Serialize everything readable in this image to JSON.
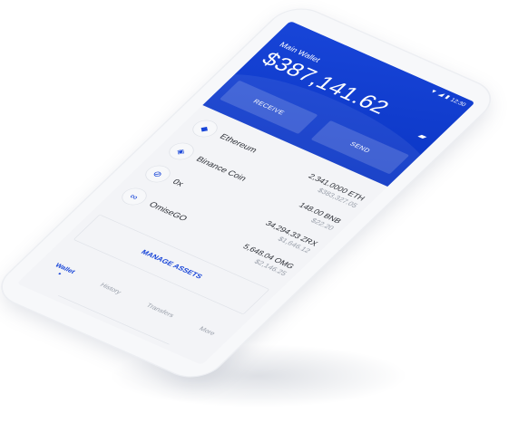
{
  "status_bar": {
    "time": "12:30",
    "icons": [
      "wifi-icon",
      "signal-icon",
      "battery-icon"
    ]
  },
  "header": {
    "title": "Main Wallet",
    "balance": "$387,141.62",
    "receive_label": "RECEIVE",
    "send_label": "SEND",
    "icon": "chat-icon"
  },
  "assets": [
    {
      "name": "Ethereum",
      "icon": "ethereum-icon",
      "amount": "2,341.0000 ETH",
      "fiat": "$383,327.05"
    },
    {
      "name": "Binance Coin",
      "icon": "binance-icon",
      "amount": "148.00 BNB",
      "fiat": "$22.20"
    },
    {
      "name": "0x",
      "icon": "zrx-icon",
      "amount": "34,294.33 ZRX",
      "fiat": "$1,646.12"
    },
    {
      "name": "OmiseGO",
      "icon": "omisego-icon",
      "amount": "5,648.04 OMG",
      "fiat": "$2,146.25"
    }
  ],
  "manage_label": "MANAGE ASSETS",
  "nav": [
    {
      "label": "Wallet",
      "active": true
    },
    {
      "label": "History"
    },
    {
      "label": "Transfers"
    },
    {
      "label": "More"
    }
  ],
  "colors": {
    "accent": "#1845d8",
    "background": "#f3f4f7"
  }
}
